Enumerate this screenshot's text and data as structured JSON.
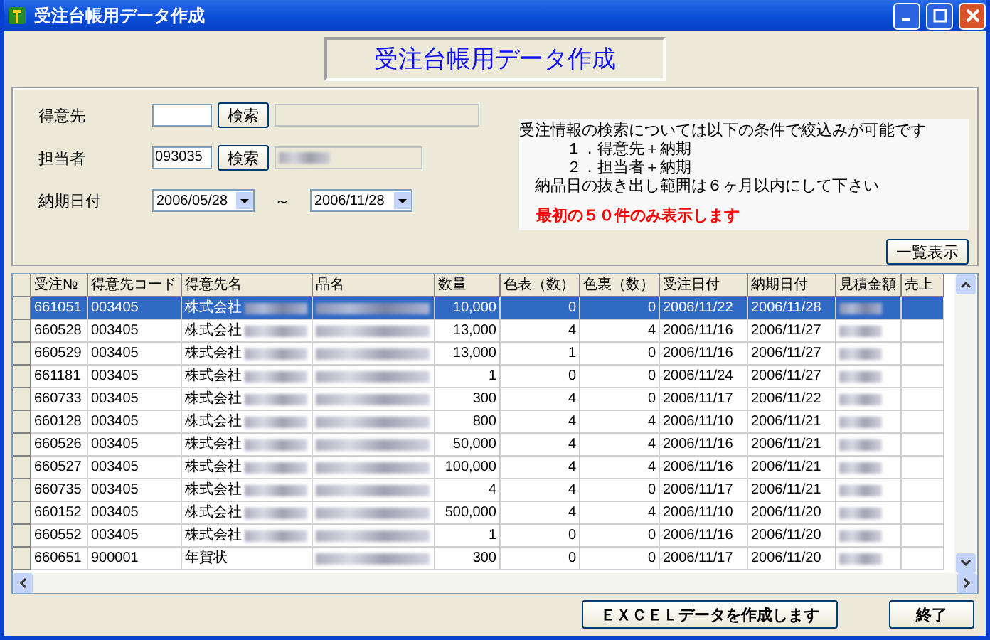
{
  "window": {
    "title": "受注台帳用データ作成"
  },
  "heading": "受注台帳用データ作成",
  "filters": {
    "customer": {
      "label": "得意先",
      "button": "検索"
    },
    "staff": {
      "label": "担当者",
      "value": "093035",
      "button": "検索",
      "name_blurred": true
    },
    "due_date": {
      "label": "納期日付",
      "from": "2006/05/28",
      "separator": "～",
      "to": "2006/11/28"
    }
  },
  "info": {
    "lines": [
      "受注情報の検索については以下の条件で絞込みが可能です",
      "　　　１．得意先＋納期",
      "　　　２．担当者＋納期",
      "　納品日の抜き出し範囲は６ヶ月以内にして下さい"
    ],
    "warning": "最初の５０件のみ表示します"
  },
  "list_button": "一覧表示",
  "table": {
    "columns": [
      "受注№",
      "得意先コード",
      "得意先名",
      "品名",
      "数量",
      "色表（数）",
      "色裏（数）",
      "受注日付",
      "納期日付",
      "見積金額",
      "売上"
    ],
    "rows": [
      {
        "selected": true,
        "cells": [
          "661051",
          "003405",
          "株式会社",
          "",
          "10,000",
          "0",
          "0",
          "2006/11/22",
          "2006/11/28",
          "",
          ""
        ],
        "name_blurred": true
      },
      {
        "selected": false,
        "cells": [
          "660528",
          "003405",
          "株式会社",
          "",
          "13,000",
          "4",
          "4",
          "2006/11/16",
          "2006/11/27",
          "",
          ""
        ],
        "name_blurred": true
      },
      {
        "selected": false,
        "cells": [
          "660529",
          "003405",
          "株式会社",
          "",
          "13,000",
          "1",
          "0",
          "2006/11/16",
          "2006/11/27",
          "",
          ""
        ],
        "name_blurred": true
      },
      {
        "selected": false,
        "cells": [
          "661181",
          "003405",
          "株式会社",
          "",
          "1",
          "0",
          "0",
          "2006/11/24",
          "2006/11/27",
          "",
          ""
        ],
        "name_blurred": true
      },
      {
        "selected": false,
        "cells": [
          "660733",
          "003405",
          "株式会社",
          "",
          "300",
          "4",
          "0",
          "2006/11/17",
          "2006/11/22",
          "",
          ""
        ],
        "name_blurred": true
      },
      {
        "selected": false,
        "cells": [
          "660128",
          "003405",
          "株式会社",
          "",
          "800",
          "4",
          "4",
          "2006/11/10",
          "2006/11/21",
          "",
          ""
        ],
        "name_blurred": true
      },
      {
        "selected": false,
        "cells": [
          "660526",
          "003405",
          "株式会社",
          "",
          "50,000",
          "4",
          "4",
          "2006/11/16",
          "2006/11/21",
          "",
          ""
        ],
        "name_blurred": true
      },
      {
        "selected": false,
        "cells": [
          "660527",
          "003405",
          "株式会社",
          "",
          "100,000",
          "4",
          "4",
          "2006/11/16",
          "2006/11/21",
          "",
          ""
        ],
        "name_blurred": true
      },
      {
        "selected": false,
        "cells": [
          "660735",
          "003405",
          "株式会社",
          "",
          "4",
          "4",
          "0",
          "2006/11/17",
          "2006/11/21",
          "",
          ""
        ],
        "name_blurred": true
      },
      {
        "selected": false,
        "cells": [
          "660152",
          "003405",
          "株式会社",
          "",
          "500,000",
          "4",
          "4",
          "2006/11/10",
          "2006/11/20",
          "",
          ""
        ],
        "name_blurred": true
      },
      {
        "selected": false,
        "cells": [
          "660552",
          "003405",
          "株式会社",
          "",
          "1",
          "0",
          "0",
          "2006/11/16",
          "2006/11/20",
          "",
          ""
        ],
        "name_blurred": true
      },
      {
        "selected": false,
        "cells": [
          "660651",
          "900001",
          "年賀状",
          "",
          "300",
          "0",
          "0",
          "2006/11/17",
          "2006/11/20",
          "",
          ""
        ],
        "name_blurred": false
      }
    ]
  },
  "buttons": [
    "ＥＸＣＥＬデータを作成します",
    "終了"
  ]
}
